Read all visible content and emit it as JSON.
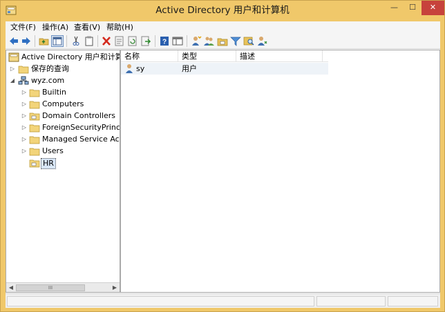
{
  "window": {
    "title": "Active Directory 用户和计算机"
  },
  "controls": {
    "minimize": "—",
    "maximize": "☐",
    "close": "✕"
  },
  "menu": [
    {
      "label": "文件(F)"
    },
    {
      "label": "操作(A)"
    },
    {
      "label": "查看(V)"
    },
    {
      "label": "帮助(H)"
    }
  ],
  "toolbar": {
    "buttons": [
      "back-icon",
      "forward-icon",
      "up-folder-icon",
      "show-hide-tree-icon",
      "cut-icon",
      "copy-icon",
      "delete-icon",
      "properties-icon",
      "refresh-icon",
      "export-list-icon",
      "help-icon",
      "console-view-icon",
      "new-user-icon",
      "new-group-icon",
      "new-ou-icon",
      "filter-icon",
      "find-icon",
      "add-to-group-icon"
    ]
  },
  "tree": {
    "root": "Active Directory 用户和计算机",
    "saved_queries": "保存的查询",
    "domain": "wyz.com",
    "children": [
      {
        "label": "Builtin",
        "icon": "folder-icon",
        "expandable": true
      },
      {
        "label": "Computers",
        "icon": "folder-icon",
        "expandable": true
      },
      {
        "label": "Domain Controllers",
        "icon": "ou-icon",
        "expandable": true
      },
      {
        "label": "ForeignSecurityPrincipals",
        "icon": "folder-icon",
        "expandable": true
      },
      {
        "label": "Managed Service Accounts",
        "icon": "folder-icon",
        "expandable": true
      },
      {
        "label": "Users",
        "icon": "folder-icon",
        "expandable": true
      },
      {
        "label": "HR",
        "icon": "ou-icon",
        "expandable": false,
        "selected": true
      }
    ]
  },
  "scrollbar": {
    "thumb_grip": "III"
  },
  "list": {
    "columns": [
      "名称",
      "类型",
      "描述"
    ],
    "rows": [
      {
        "name": "sy",
        "type": "用户",
        "description": ""
      }
    ]
  },
  "colors": {
    "titlebar": "#f0c86a",
    "close_button": "#c7423c",
    "selection": "#d8e6f7"
  }
}
